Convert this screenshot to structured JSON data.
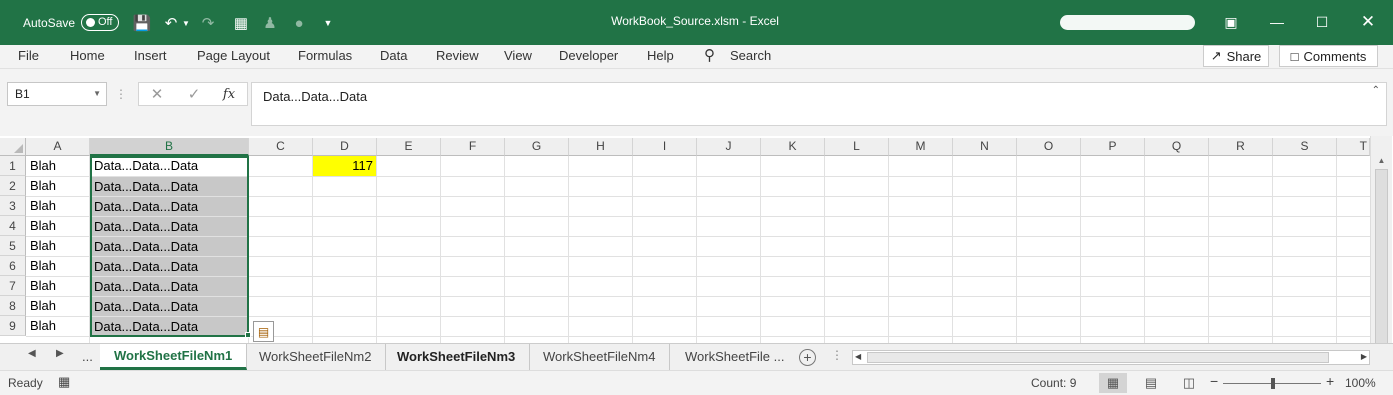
{
  "titlebar": {
    "autosave_label": "AutoSave",
    "autosave_state": "Off",
    "window_title": "WorkBook_Source.xlsm  -  Excel",
    "bg_color": "#217346"
  },
  "ribbon": {
    "menus": [
      "File",
      "Home",
      "Insert",
      "Page Layout",
      "Formulas",
      "Data",
      "Review",
      "View",
      "Developer",
      "Help"
    ],
    "search_label": "Search",
    "share_label": "Share",
    "comments_label": "Comments"
  },
  "formula_bar": {
    "name_box": "B1",
    "fx_label": "fx",
    "formula": "Data...Data...Data"
  },
  "grid": {
    "columns": [
      "A",
      "B",
      "C",
      "D",
      "E",
      "F",
      "G",
      "H",
      "I",
      "J",
      "K",
      "L",
      "M",
      "N",
      "O",
      "P",
      "Q",
      "R",
      "S",
      "T"
    ],
    "rows": [
      "1",
      "2",
      "3",
      "4",
      "5",
      "6",
      "7",
      "8",
      "9"
    ],
    "colA": [
      "Blah",
      "Blah",
      "Blah",
      "Blah",
      "Blah",
      "Blah",
      "Blah",
      "Blah",
      "Blah"
    ],
    "colB": [
      "Data...Data...Data",
      "Data...Data...Data",
      "Data...Data...Data",
      "Data...Data...Data",
      "Data...Data...Data",
      "Data...Data...Data",
      "Data...Data...Data",
      "Data...Data...Data",
      "Data...Data...Data"
    ],
    "d1": "117",
    "selected_column": "B",
    "highlight_color": "#ffff00"
  },
  "sheets": {
    "ellipsis": "...",
    "tabs": [
      "WorkSheetFileNm1",
      "WorkSheetFileNm2",
      "WorkSheetFileNm3",
      "WorkSheetFileNm4",
      "WorkSheetFile ..."
    ],
    "active": "WorkSheetFileNm1"
  },
  "status": {
    "ready": "Ready",
    "count": "Count: 9",
    "zoom": "100%"
  }
}
